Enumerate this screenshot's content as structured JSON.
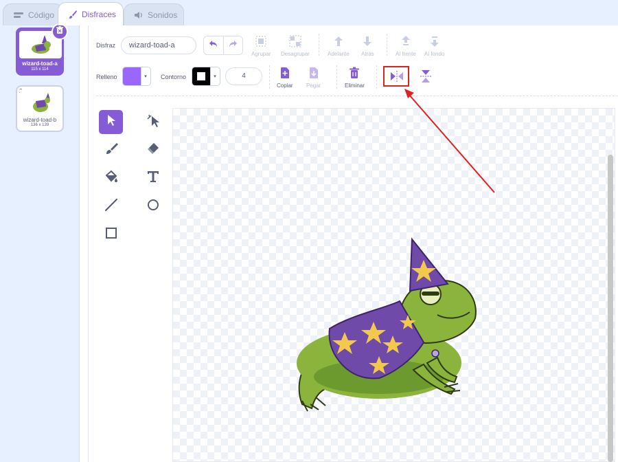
{
  "tabs": [
    {
      "label": "Código",
      "icon": "code-blocks-icon"
    },
    {
      "label": "Disfraces",
      "icon": "paintbrush-icon"
    },
    {
      "label": "Sonidos",
      "icon": "speaker-icon"
    }
  ],
  "costumes": [
    {
      "number": "1",
      "name": "wizard-toad-a",
      "size": "115 x 114",
      "selected": true
    },
    {
      "number": "2",
      "name": "wizard-toad-b",
      "size": "136 x 139",
      "selected": false
    }
  ],
  "toolbar": {
    "costume_label": "Disfraz",
    "costume_name": "wizard-toad-a",
    "group_label": "Agrupar",
    "ungroup_label": "Desagrupar",
    "forward_label": "Adelante",
    "backward_label": "Atrás",
    "front_label": "Al frente",
    "back_label": "Al fondo",
    "fill_label": "Relleno",
    "outline_label": "Contorno",
    "outline_size": "4",
    "copy_label": "Copiar",
    "paste_label": "Pegar",
    "delete_label": "Eliminar",
    "fill_color": "#9966ff",
    "outline_color": "#000000"
  },
  "palette_tools": [
    "select-arrow-icon",
    "reshape-icon",
    "brush-icon",
    "eraser-icon",
    "fill-bucket-icon",
    "text-tool-icon",
    "line-tool-icon",
    "circle-tool-icon",
    "rectangle-tool-icon"
  ],
  "colors": {
    "accent": "#855cd6",
    "highlight": "#e02121"
  }
}
